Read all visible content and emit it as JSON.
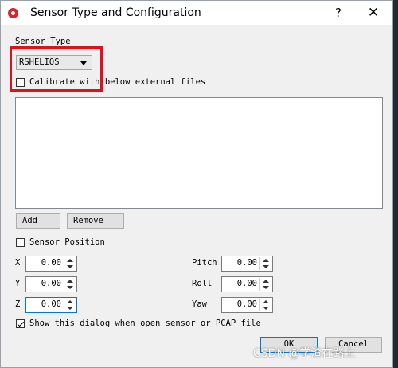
{
  "window": {
    "title": "Sensor Type and Configuration",
    "help_label": "?",
    "close_label": "✕"
  },
  "sensor_type": {
    "group_label": "Sensor Type",
    "selected": "RSHELIOS"
  },
  "calibrate": {
    "label": "Calibrate with below external files",
    "checked": false
  },
  "file_buttons": {
    "add": "Add",
    "remove": "Remove"
  },
  "sensor_position": {
    "label": "Sensor Position",
    "checked": false,
    "fields": {
      "x": {
        "label": "X",
        "value": "0.00"
      },
      "y": {
        "label": "Y",
        "value": "0.00"
      },
      "z": {
        "label": "Z",
        "value": "0.00"
      },
      "pitch": {
        "label": "Pitch",
        "value": "0.00"
      },
      "roll": {
        "label": "Roll",
        "value": "0.00"
      },
      "yaw": {
        "label": "Yaw",
        "value": "0.00"
      }
    }
  },
  "show_dialog": {
    "label": "Show this dialog when open sensor or PCAP file",
    "checked": true
  },
  "actions": {
    "ok": "OK",
    "cancel": "Cancel"
  },
  "watermark": "CSDN @学渣在路上",
  "colors": {
    "highlight_box": "#e0101c",
    "app_icon": "#d6262e",
    "focus": "#0078d7"
  }
}
